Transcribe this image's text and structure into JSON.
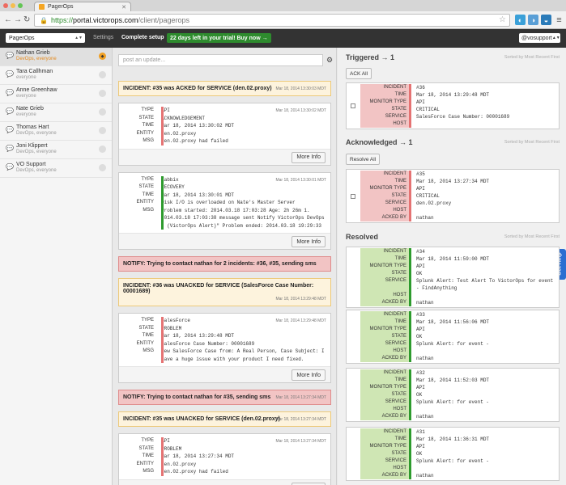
{
  "browser": {
    "tab_title": "PagerOps",
    "url_scheme": "https://",
    "url_host": "portal.victorops.com",
    "url_path": "/client/pagerops"
  },
  "header": {
    "org_select": "PagerOps",
    "settings": "Settings",
    "complete_setup": "Complete setup",
    "trial": "22 days left in your trial! Buy now →",
    "user": "@vosupport"
  },
  "sidebar": {
    "people": [
      {
        "name": "Nathan Grieb",
        "team": "DevOps, everyone",
        "status": "alerting"
      },
      {
        "name": "Tara Callhman",
        "team": "everyone",
        "status": "idle"
      },
      {
        "name": "Anne Greenhaw",
        "team": "everyone",
        "status": "idle"
      },
      {
        "name": "Nate Grieb",
        "team": "everyone",
        "status": "idle"
      },
      {
        "name": "Thomas Hart",
        "team": "DevOps, everyone",
        "status": "idle"
      },
      {
        "name": "Joni Klippert",
        "team": "DevOps, everyone",
        "status": "idle"
      },
      {
        "name": "VO Support",
        "team": "DevOps, everyone",
        "status": "idle"
      }
    ]
  },
  "timeline": {
    "post_placeholder": "post an update...",
    "more_info": "More Info",
    "b1": {
      "text": "INCIDENT: #35 was ACKED for SERVICE (den.02.proxy)",
      "ts": "Mar 18, 2014 13:30:03 MDT"
    },
    "c1": {
      "ts": "Mar 18, 2014 13:30:02 MDT",
      "rows": [
        [
          "TYPE",
          "API"
        ],
        [
          "STATE",
          "ACKNOWLEDGEMENT"
        ],
        [
          "TIME",
          "Mar 18, 2014 13:30:02 MDT"
        ],
        [
          "ENTITY",
          "den.02.proxy"
        ],
        [
          "MSG",
          "den.02.proxy had failed"
        ]
      ]
    },
    "c2": {
      "ts": "Mar 18, 2014 13:30:01 MDT",
      "rows": [
        [
          "TYPE",
          "Zabbix"
        ],
        [
          "STATE",
          "RECOVERY"
        ],
        [
          "TIME",
          "Mar 18, 2014 13:30:01 MDT"
        ],
        [
          "ENTITY",
          "Disk I/O is overloaded on Nate's Master Server"
        ],
        [
          "MSG",
          "Problem started: 2014.03.18 17:03:28 Age: 2h 26m 1. 2014.03.18 17:03:38 message sent Notify VictorOps DevOps \" (VictorOps Alert)\" Problem ended: 2014.03.18 19:29:33"
        ]
      ]
    },
    "b2": {
      "text": "NOTIFY: Trying to contact nathan for 2 incidents: #36, #35, sending sms",
      "ts": ""
    },
    "b3": {
      "text": "INCIDENT: #36 was UNACKED for SERVICE (SalesForce Case Number: 00001689)",
      "ts": "Mar 18, 2014 13:29:48 MDT"
    },
    "c3": {
      "ts": "Mar 18, 2014 13:29:48 MDT",
      "rows": [
        [
          "TYPE",
          "SalesForce"
        ],
        [
          "STATE",
          "PROBLEM"
        ],
        [
          "TIME",
          "Mar 18, 2014 13:29:48 MDT"
        ],
        [
          "ENTITY",
          "SalesForce Case Number: 00001689"
        ],
        [
          "MSG",
          "New SalesForce Case from: A Real Person, Case Subject: I have a huge issue with your product I need fixed."
        ]
      ]
    },
    "b4": {
      "text": "NOTIFY: Trying to contact nathan for #35, sending sms",
      "ts": "Mar 18, 2014 13:27:34 MDT"
    },
    "b5": {
      "text": "INCIDENT: #35 was UNACKED for SERVICE (den.02.proxy)",
      "ts": "Mar 18, 2014 13:27:34 MDT"
    },
    "c4": {
      "ts": "Mar 18, 2014 13:27:34 MDT",
      "rows": [
        [
          "TYPE",
          "API"
        ],
        [
          "STATE",
          "PROBLEM"
        ],
        [
          "TIME",
          "Mar 18, 2014 13:27:34 MDT"
        ],
        [
          "ENTITY",
          "den.02.proxy"
        ],
        [
          "MSG",
          "den.02.proxy had failed"
        ]
      ]
    }
  },
  "right": {
    "sorted": "Sorted by Most Recent First",
    "triggered": {
      "title": "Triggered → 1",
      "button": "ACK All",
      "rows": [
        [
          "INCIDENT",
          "#36"
        ],
        [
          "TIME",
          "Mar 18, 2014 13:29:48 MDT"
        ],
        [
          "MONITOR TYPE",
          "API"
        ],
        [
          "STATE",
          "CRITICAL"
        ],
        [
          "SERVICE",
          "SalesForce Case Number: 00001689"
        ],
        [
          "HOST",
          ""
        ]
      ]
    },
    "acknowledged": {
      "title": "Acknowledged → 1",
      "button": "Resolve All",
      "rows": [
        [
          "INCIDENT",
          "#35"
        ],
        [
          "TIME",
          "Mar 18, 2014 13:27:34 MDT"
        ],
        [
          "MONITOR TYPE",
          "API"
        ],
        [
          "STATE",
          "CRITICAL"
        ],
        [
          "SERVICE",
          "den.02.proxy"
        ],
        [
          "HOST",
          ""
        ],
        [
          "ACKED BY",
          "nathan"
        ]
      ]
    },
    "resolved": {
      "title": "Resolved",
      "cards": [
        [
          [
            "INCIDENT",
            "#34"
          ],
          [
            "TIME",
            "Mar 18, 2014 11:59:00 MDT"
          ],
          [
            "MONITOR TYPE",
            "API"
          ],
          [
            "STATE",
            "OK"
          ],
          [
            "SERVICE",
            "Splunk Alert: Test Alert To VictorOps for event - FindAnything"
          ],
          [
            "HOST",
            ""
          ],
          [
            "ACKED BY",
            "nathan"
          ]
        ],
        [
          [
            "INCIDENT",
            "#33"
          ],
          [
            "TIME",
            "Mar 18, 2014 11:56:06 MDT"
          ],
          [
            "MONITOR TYPE",
            "API"
          ],
          [
            "STATE",
            "OK"
          ],
          [
            "SERVICE",
            "Splunk Alert: for event -"
          ],
          [
            "HOST",
            ""
          ],
          [
            "ACKED BY",
            "nathan"
          ]
        ],
        [
          [
            "INCIDENT",
            "#32"
          ],
          [
            "TIME",
            "Mar 18, 2014 11:52:03 MDT"
          ],
          [
            "MONITOR TYPE",
            "API"
          ],
          [
            "STATE",
            "OK"
          ],
          [
            "SERVICE",
            "Splunk Alert: for event -"
          ],
          [
            "HOST",
            ""
          ],
          [
            "ACKED BY",
            "nathan"
          ]
        ],
        [
          [
            "INCIDENT",
            "#31"
          ],
          [
            "TIME",
            "Mar 18, 2014 11:36:31 MDT"
          ],
          [
            "MONITOR TYPE",
            "API"
          ],
          [
            "STATE",
            "OK"
          ],
          [
            "SERVICE",
            "Splunk Alert: for event -"
          ],
          [
            "HOST",
            ""
          ],
          [
            "ACKED BY",
            "nathan"
          ]
        ]
      ]
    },
    "help": "Get Help"
  }
}
